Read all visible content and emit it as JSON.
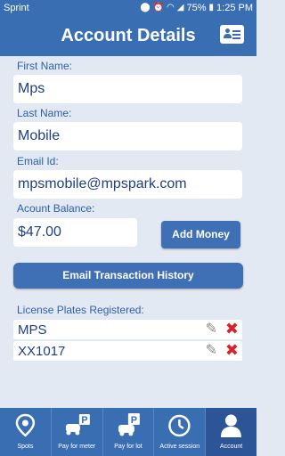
{
  "status_bar": {
    "carrier": "Sprint",
    "battery": "75%",
    "time": "1:25 PM",
    "icons": [
      "location-icon",
      "alarm-icon",
      "wifi-icon",
      "signal-icon",
      "battery-icon"
    ]
  },
  "header": {
    "title": "Account Details",
    "action_icon": "contact-card-icon"
  },
  "form": {
    "first_name_label": "First Name:",
    "first_name_value": "Mps",
    "last_name_label": "Last Name:",
    "last_name_value": "Mobile",
    "email_label": "Email Id:",
    "email_value": "mpsmobile@mpspark.com",
    "balance_label": "Acount Balance:",
    "balance_value": "$47.00",
    "add_money_label": "Add Money",
    "email_history_label": "Email Transaction History"
  },
  "plates": {
    "label": "License Plates Registered:",
    "items": [
      {
        "number": "MPS"
      },
      {
        "number": "XX1017"
      }
    ]
  },
  "tabs": [
    {
      "label": "Spots",
      "icon": "map-pin-icon"
    },
    {
      "label": "Pay for meter",
      "icon": "parking-meter-icon"
    },
    {
      "label": "Pay for lot",
      "icon": "parking-car-icon"
    },
    {
      "label": "Active session",
      "icon": "timer-icon"
    },
    {
      "label": "Account",
      "icon": "user-icon",
      "active": true
    }
  ],
  "colors": {
    "primary": "#3a6eb3",
    "background": "#e3e9f2",
    "text": "#1d3f86",
    "delete": "#d9222a"
  }
}
